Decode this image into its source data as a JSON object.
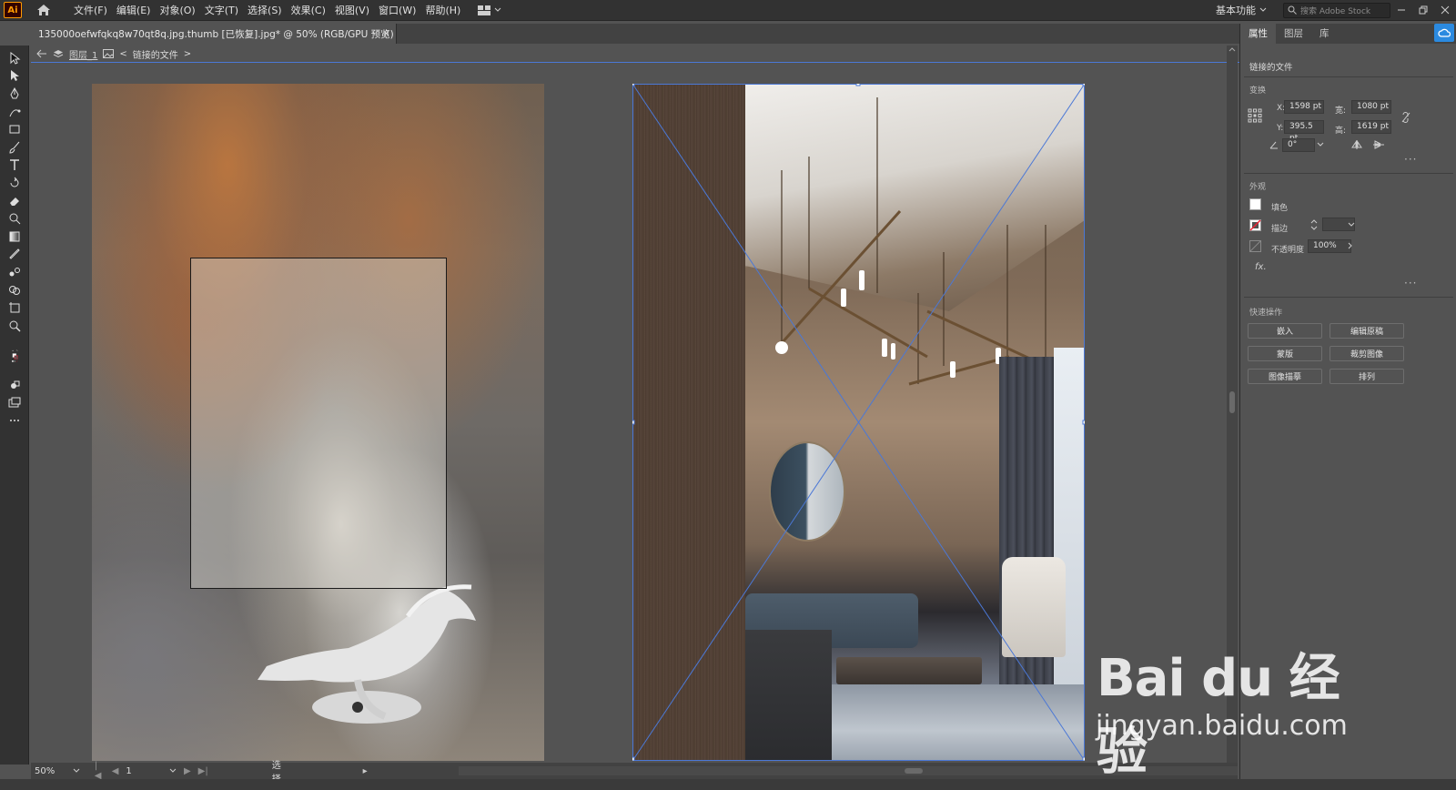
{
  "app": {
    "logo": "Ai"
  },
  "menu": [
    "文件(F)",
    "编辑(E)",
    "对象(O)",
    "文字(T)",
    "选择(S)",
    "效果(C)",
    "视图(V)",
    "窗口(W)",
    "帮助(H)"
  ],
  "topbar": {
    "workspace": "基本功能",
    "stock_placeholder": "搜索 Adobe Stock"
  },
  "document_tab": {
    "title": "135000oefwfqkq8w70qt8q.jpg.thumb [已恢复].jpg* @ 50% (RGB/GPU 预览)",
    "close": "×"
  },
  "isolation": {
    "layer": "图层_1",
    "object": "链接的文件"
  },
  "panel": {
    "tabs": [
      "属性",
      "图层",
      "库"
    ],
    "object_type": "链接的文件",
    "transform": {
      "title": "变换",
      "x_label": "X:",
      "x": "1598 pt",
      "y_label": "Y:",
      "y": "395.5 pt",
      "w_label": "宽:",
      "w": "1080 pt",
      "h_label": "高:",
      "h": "1619 pt",
      "angle": "0°"
    },
    "appearance": {
      "title": "外观",
      "fill": "填色",
      "stroke": "描边",
      "opacity_label": "不透明度",
      "opacity": "100%",
      "fx": "fx."
    },
    "quick_actions": {
      "title": "快速操作",
      "embed": "嵌入",
      "edit_original": "编辑原稿",
      "mask": "蒙版",
      "crop_image": "裁剪图像",
      "image_trace": "图像描摹",
      "arrange": "排列"
    }
  },
  "status": {
    "zoom": "50%",
    "page": "1",
    "tool": "选择"
  },
  "watermark": {
    "logo": "Bai du 经验",
    "url": "jingyan.baidu.com"
  },
  "colors": {
    "accent_blue": "#4b78d6",
    "cc_blue": "#2b8ae0",
    "logo_orange": "#ff9a00"
  }
}
